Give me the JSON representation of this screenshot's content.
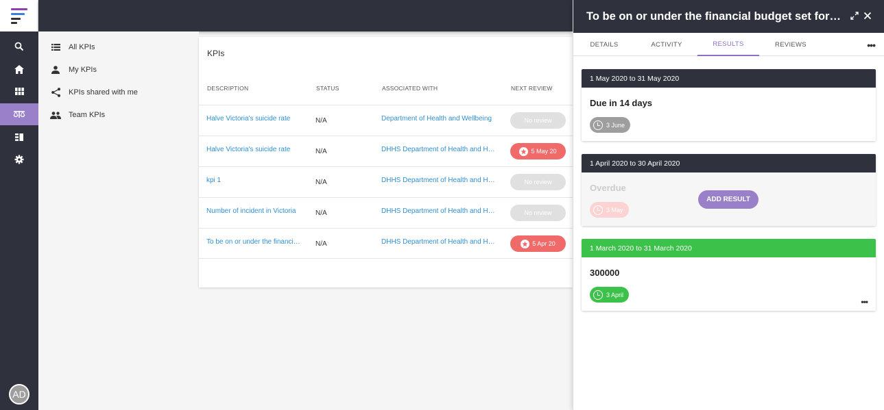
{
  "colors": {
    "rail": "#2f323d",
    "accent": "#9a7fc9",
    "link": "#2f8fd1",
    "overdue": "#f06a6a",
    "success": "#3cc14a",
    "period_dark": "#2f323d"
  },
  "rail": {
    "items": [
      {
        "icon": "search-icon"
      },
      {
        "icon": "home-icon"
      },
      {
        "icon": "apps-grid-icon"
      },
      {
        "icon": "scales-icon",
        "active": true
      },
      {
        "icon": "list-view-icon"
      },
      {
        "icon": "gear-icon"
      }
    ],
    "avatar_initials": "AD"
  },
  "subnav": {
    "items": [
      {
        "label": "All KPIs",
        "icon": "list-icon"
      },
      {
        "label": "My KPIs",
        "icon": "person-icon"
      },
      {
        "label": "KPIs shared with me",
        "icon": "share-icon"
      },
      {
        "label": "Team KPIs",
        "icon": "group-icon"
      }
    ]
  },
  "kpi_table": {
    "title": "KPIs",
    "headers": {
      "description": "DESCRIPTION",
      "status": "STATUS",
      "associated": "ASSOCIATED WITH",
      "next_review": "NEXT REVIEW"
    },
    "rows": [
      {
        "description": "Halve Victoria's suicide rate",
        "status": "N/A",
        "associated": "Department of Health and Wellbeing",
        "review": "No review",
        "review_type": "none"
      },
      {
        "description": "Halve Victoria's suicide rate",
        "status": "N/A",
        "associated": "DHHS Department of Health and Human Services",
        "review": "5 May 20",
        "review_type": "due"
      },
      {
        "description": "kpi 1",
        "status": "N/A",
        "associated": "DHHS Department of Health and Human Services",
        "review": "No review",
        "review_type": "none"
      },
      {
        "description": "Number of incident in Victoria",
        "status": "N/A",
        "associated": "DHHS Department of Health and Human Services",
        "review": "No review",
        "review_type": "none"
      },
      {
        "description": "To be on or under the financial budget",
        "status": "N/A",
        "associated": "DHHS Department of Health and Human Services",
        "review": "5 Apr 20",
        "review_type": "due"
      }
    ]
  },
  "panel": {
    "title": "To be on or under the financial budget set for the year",
    "tabs": [
      {
        "label": "DETAILS"
      },
      {
        "label": "ACTIVITY"
      },
      {
        "label": "RESULTS",
        "active": true
      },
      {
        "label": "REVIEWS"
      }
    ],
    "more_label": "•••",
    "results": [
      {
        "period": "1 May 2020 to 31 May 2020",
        "title": "Due in 14 days",
        "chip": "3 June",
        "state": "due"
      },
      {
        "period": "1 April 2020 to 30 April 2020",
        "title": "Overdue",
        "chip": "3 May",
        "state": "overdue",
        "action": "ADD RESULT"
      },
      {
        "period": "1 March 2020 to 31 March 2020",
        "title": "300000",
        "chip": "3 April",
        "state": "done",
        "more": "•••"
      }
    ]
  }
}
